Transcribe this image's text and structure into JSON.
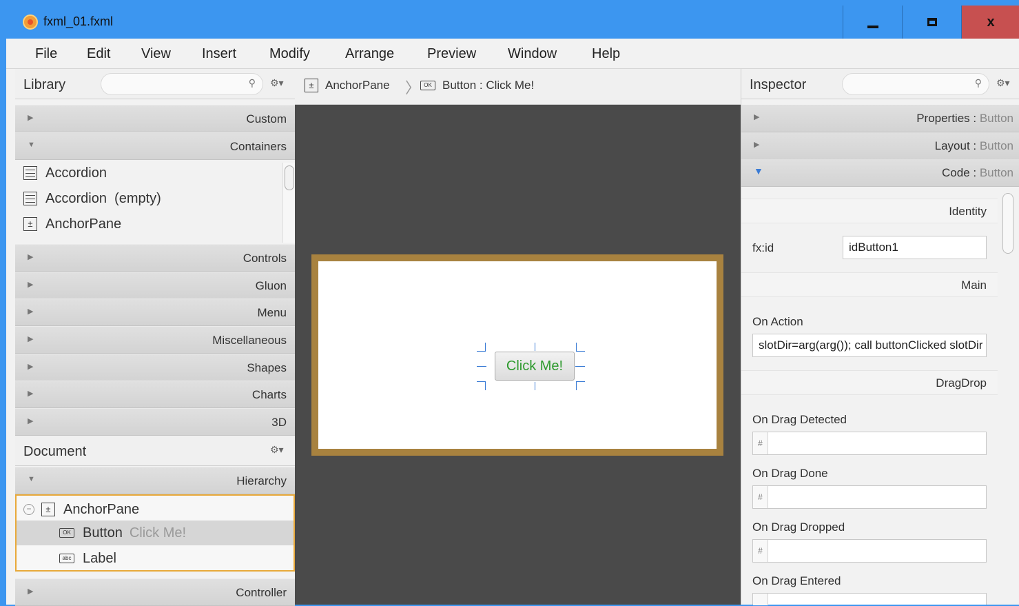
{
  "window": {
    "title": "fxml_01.fxml",
    "close_glyph": "x"
  },
  "menu": [
    "File",
    "Edit",
    "View",
    "Insert",
    "Modify",
    "Arrange",
    "Preview",
    "Window",
    "Help"
  ],
  "library": {
    "title": "Library",
    "sections_top": [
      "Custom",
      "Containers"
    ],
    "items": [
      "Accordion",
      "Accordion  (empty)",
      "AnchorPane"
    ],
    "sections_bottom": [
      "Controls",
      "Gluon",
      "Menu",
      "Miscellaneous",
      "Shapes",
      "Charts",
      "3D"
    ]
  },
  "document": {
    "title": "Document",
    "hierarchy_label": "Hierarchy",
    "root": "AnchorPane",
    "button_label": "Button",
    "button_text": "Click Me!",
    "label_item": "Label",
    "controller_label": "Controller"
  },
  "breadcrumb": {
    "first": "AnchorPane",
    "second": "Button : Click Me!"
  },
  "canvas": {
    "button_text": "Click Me!"
  },
  "inspector": {
    "title": "Inspector",
    "sections": [
      {
        "name": "Properties",
        "sub": "Button"
      },
      {
        "name": "Layout",
        "sub": "Button"
      },
      {
        "name": "Code",
        "sub": "Button"
      }
    ],
    "identity": "Identity",
    "fxid_label": "fx:id",
    "fxid_value": "idButton1",
    "main": "Main",
    "on_action_label": "On Action",
    "on_action_value": "slotDir=arg(arg()); call buttonClicked slotDir",
    "dragdrop": "DragDrop",
    "drag_fields": [
      "On Drag Detected",
      "On Drag Done",
      "On Drag Dropped",
      "On Drag Entered"
    ],
    "hash": "#"
  },
  "icons": {
    "ok": "OK",
    "abc": "abc",
    "anchor": "±"
  },
  "colors": {
    "accent": "#3c96f0",
    "close": "#c75050",
    "stage_border": "#a8823f",
    "selection": "#e8a93a",
    "button_text": "#2d9a2d"
  }
}
